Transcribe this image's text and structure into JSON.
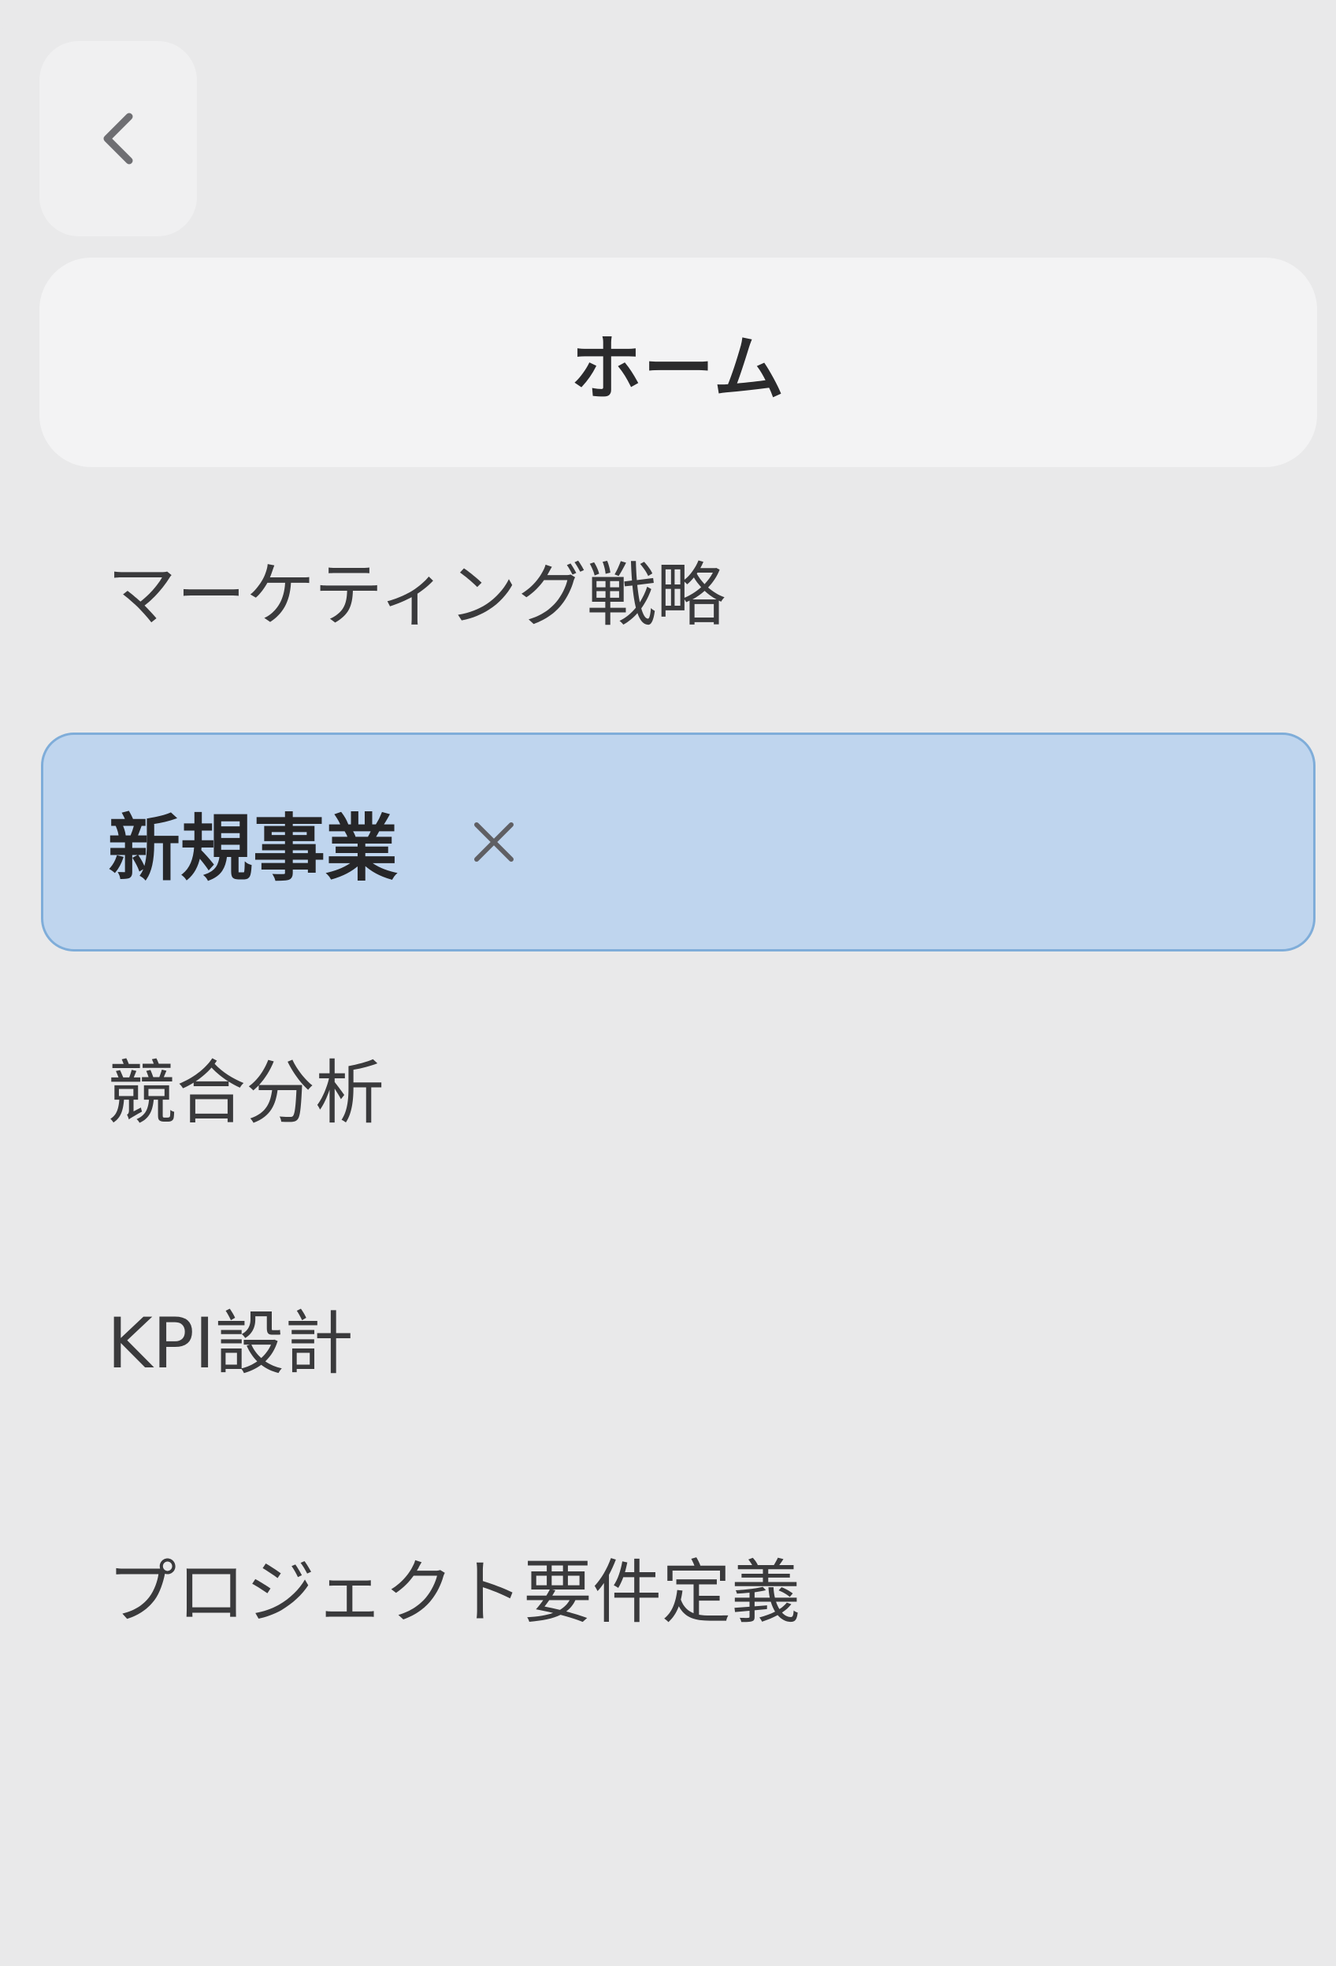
{
  "header": {
    "back_icon": "chevron-left-icon",
    "home_label": "ホーム"
  },
  "nav": {
    "items": [
      {
        "label": "マーケティング戦略",
        "active": false
      },
      {
        "label": "新規事業",
        "active": true,
        "close_icon": "close-icon"
      },
      {
        "label": "競合分析",
        "active": false
      },
      {
        "label": "KPI設計",
        "active": false
      },
      {
        "label": "プロジェクト要件定義",
        "active": false
      }
    ]
  },
  "colors": {
    "background": "#e9e9ea",
    "active_fill": "#bfd5ee",
    "active_border": "#7fadd9",
    "text": "#3a3a3c"
  }
}
